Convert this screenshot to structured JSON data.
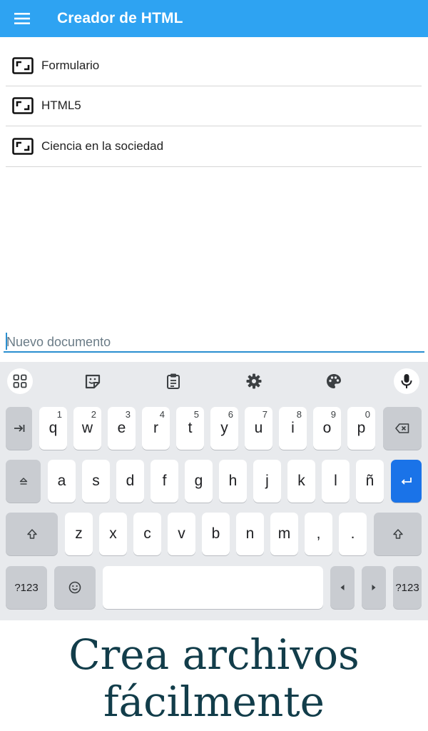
{
  "app_bar": {
    "title": "Creador de HTML",
    "menu_icon": "hamburger-menu-icon",
    "color": "#2ea3f2"
  },
  "documents": [
    {
      "label": "Formulario",
      "icon": "document-frame-icon"
    },
    {
      "label": "HTML5",
      "icon": "document-frame-icon"
    },
    {
      "label": "Ciencia en la sociedad",
      "icon": "document-frame-icon"
    }
  ],
  "new_document": {
    "placeholder": "Nuevo documento",
    "value": "",
    "accent": "#2a8fd0"
  },
  "keyboard": {
    "toolbar": [
      "apps-grid-icon",
      "sticker-icon",
      "clipboard-icon",
      "settings-gear-icon",
      "theme-palette-icon",
      "microphone-icon"
    ],
    "row1": {
      "letters": [
        "q",
        "w",
        "e",
        "r",
        "t",
        "y",
        "u",
        "i",
        "o",
        "p"
      ],
      "hints": [
        "1",
        "2",
        "3",
        "4",
        "5",
        "6",
        "7",
        "8",
        "9",
        "0"
      ]
    },
    "row2": [
      "a",
      "s",
      "d",
      "f",
      "g",
      "h",
      "j",
      "k",
      "l",
      "ñ"
    ],
    "row3": [
      "z",
      "x",
      "c",
      "v",
      "b",
      "n",
      "m",
      ",",
      "."
    ],
    "symbols_label": "?123",
    "enter_color": "#1a73e8"
  },
  "promo": {
    "line1": "Crea archivos",
    "line2": "fácilmente"
  }
}
